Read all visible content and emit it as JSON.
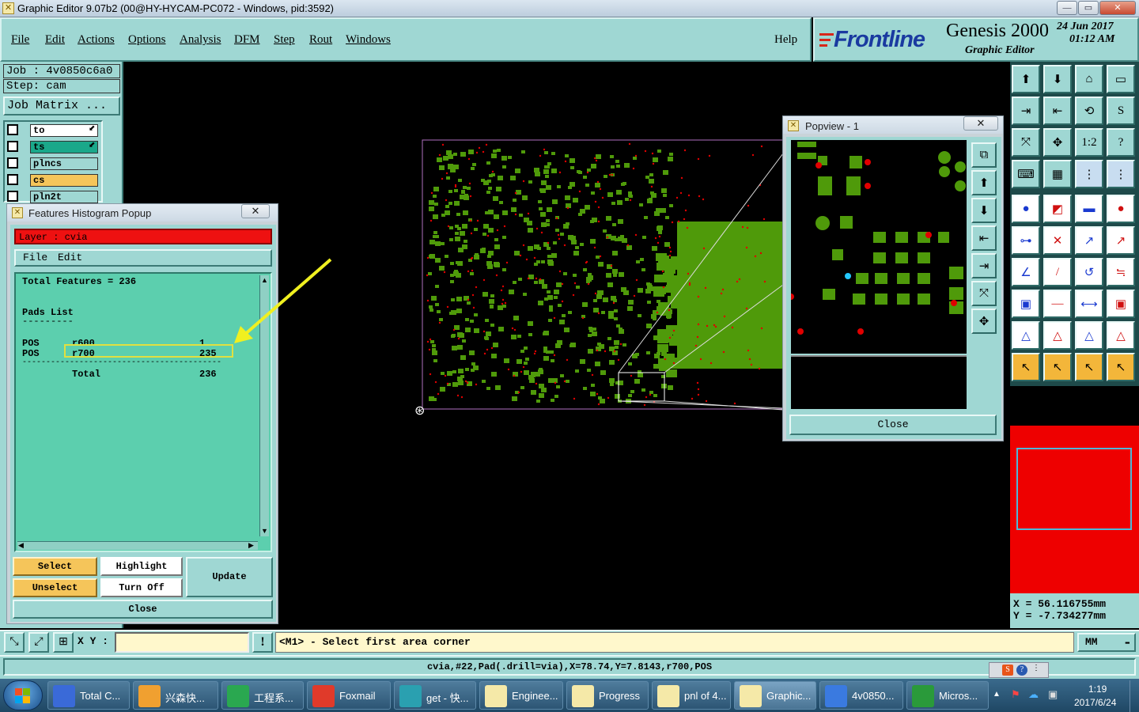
{
  "window": {
    "title": "Graphic Editor 9.07b2 (00@HY-HYCAM-PC072 - Windows, pid:3592)"
  },
  "menu": {
    "items": [
      "File",
      "Edit",
      "Actions",
      "Options",
      "Analysis",
      "DFM",
      "Step",
      "Rout",
      "Windows"
    ],
    "help": "Help"
  },
  "brand": {
    "logo": "Frontline",
    "product": "Genesis 2000",
    "subtitle": "Graphic Editor",
    "date": "24 Jun 2017",
    "time": "01:12 AM"
  },
  "job": {
    "job_label": "Job : 4v0850c6a0",
    "step_label": "Step: cam",
    "matrix_button": "Job Matrix ..."
  },
  "layers": [
    {
      "name": "to",
      "color": "#ffffff"
    },
    {
      "name": "ts",
      "color": "#1aa88a"
    },
    {
      "name": "plncs",
      "color": "#9fd7d3"
    },
    {
      "name": "cs",
      "color": "#f5c55a"
    },
    {
      "name": "pln2t",
      "color": "#9fd7d3"
    }
  ],
  "histogram": {
    "title": "Features Histogram Popup",
    "layer_label": "Layer :  cvia",
    "menu": [
      "File",
      "Edit"
    ],
    "total_line": "Total Features = 236",
    "pads_heading": "Pads List",
    "pads_underline": "---------",
    "rows": [
      {
        "pol": "POS",
        "sym": "r600",
        "count": "1"
      },
      {
        "pol": "POS",
        "sym": "r700",
        "count": "235"
      }
    ],
    "separator": "------------------------------------------",
    "total_label": "Total",
    "total_count": "236",
    "buttons": {
      "select": "Select",
      "highlight": "Highlight",
      "update": "Update",
      "unselect": "Unselect",
      "turn_off": "Turn Off",
      "close": "Close"
    }
  },
  "popview": {
    "title": "Popview - 1",
    "close": "Close"
  },
  "coords": {
    "x": "X  = 56.116755mm",
    "y": "Y  = -7.734277mm"
  },
  "status": {
    "xy_label": "X Y :",
    "xy_value": "",
    "prompt": "<M1> - Select first area corner",
    "units": "MM",
    "info_line": "cvia,#22,Pad(.drill=via),X=78.74,Y=7.8143,r700,POS"
  },
  "taskbar": {
    "items": [
      "Total C...",
      "兴森快...",
      "工程系...",
      "Foxmail",
      "get - 快...",
      "Enginee...",
      "Progress",
      "pnl of 4...",
      "Graphic...",
      "4v0850...",
      "Micros..."
    ],
    "clock_time": "1:19",
    "clock_date": "2017/6/24"
  },
  "colors": {
    "pad_green": "#4f9a0a",
    "via_red": "#e00000",
    "panel_teal": "#9fd7d3",
    "histogram_bg": "#5ccfae",
    "layer_red": "#ee0000"
  }
}
